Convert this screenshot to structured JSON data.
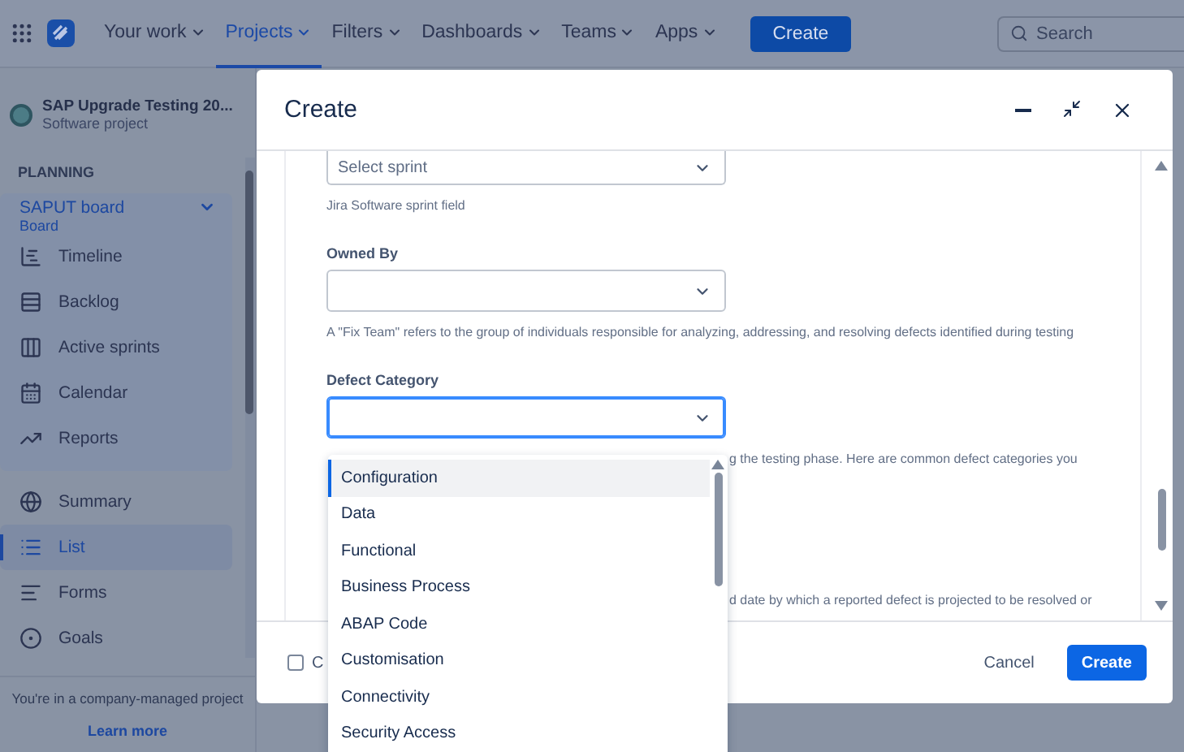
{
  "top_nav": {
    "items": [
      {
        "label": "Your work",
        "selected": false
      },
      {
        "label": "Projects",
        "selected": true
      },
      {
        "label": "Filters",
        "selected": false
      },
      {
        "label": "Dashboards",
        "selected": false
      },
      {
        "label": "Teams",
        "selected": false
      },
      {
        "label": "Apps",
        "selected": false
      }
    ],
    "create_button": "Create",
    "search": {
      "placeholder": "Search"
    }
  },
  "sidebar": {
    "project": {
      "name": "SAP Upgrade Testing 20...",
      "type": "Software project"
    },
    "section_heading": "PLANNING",
    "board": {
      "name": "SAPUT board",
      "subtitle": "Board",
      "expanded": true,
      "items": [
        {
          "label": "Timeline",
          "selected": false
        },
        {
          "label": "Backlog",
          "selected": false
        },
        {
          "label": "Active sprints",
          "selected": false
        },
        {
          "label": "Calendar",
          "selected": false
        },
        {
          "label": "Reports",
          "selected": false
        }
      ]
    },
    "items": [
      {
        "label": "Summary",
        "selected": false
      },
      {
        "label": "List",
        "selected": true
      },
      {
        "label": "Forms",
        "selected": false
      },
      {
        "label": "Goals",
        "selected": false
      }
    ],
    "footer": {
      "text": "You're in a company-managed project",
      "link": "Learn more"
    }
  },
  "dialog": {
    "title": "Create",
    "fields": [
      {
        "placeholder": "Select sprint",
        "hint": "Jira Software sprint field",
        "focused": false
      },
      {
        "label": "Owned By",
        "hint": "A \"Fix Team\" refers to the group of individuals responsible for analyzing, addressing, and resolving defects identified during testing",
        "focused": false
      },
      {
        "label": "Defect Category",
        "hint": "g the testing phase. Here are common defect categories you",
        "focused": true
      }
    ],
    "trailing_hint": "d date by which a reported defect is projected to be resolved or",
    "footer": {
      "checkbox": {
        "label": "C",
        "checked": false
      },
      "buttons": [
        {
          "label": "Cancel",
          "kind": "subtle"
        },
        {
          "label": "Create",
          "kind": "primary"
        }
      ]
    },
    "dropdown": {
      "open": true,
      "options": [
        {
          "label": "Configuration",
          "selected": true
        },
        {
          "label": "Data",
          "selected": false
        },
        {
          "label": "Functional",
          "selected": false
        },
        {
          "label": "Business Process",
          "selected": false
        },
        {
          "label": "ABAP Code",
          "selected": false
        },
        {
          "label": "Customisation",
          "selected": false
        },
        {
          "label": "Connectivity",
          "selected": false
        },
        {
          "label": "Security Access",
          "selected": false
        }
      ]
    }
  }
}
